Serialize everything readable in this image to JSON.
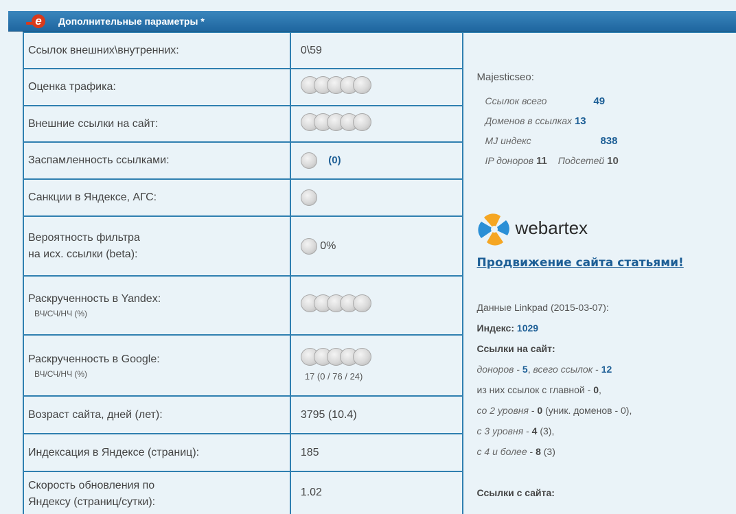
{
  "header": {
    "logo_letter": "e",
    "title": "Дополнительные параметры *"
  },
  "rows": [
    {
      "label": "Ссылок внешних\\внутренних:",
      "value": "0\\59"
    },
    {
      "label": "Оценка трафика:"
    },
    {
      "label": "Внешние ссылки на сайт:"
    },
    {
      "label": "Заспамленность ссылками:",
      "value": "(0)"
    },
    {
      "label": "Санкции в Яндексе, АГС:"
    },
    {
      "label1": "Вероятность фильтра",
      "label2": "на исх. ссылки (beta):",
      "value": "0%"
    },
    {
      "label1": "Раскрученность в Yandex:",
      "sub": "ВЧ/СЧ/НЧ (%)"
    },
    {
      "label1": "Раскрученность в Google:",
      "sub": "ВЧ/СЧ/НЧ (%)",
      "value": "17 (0 / 76 / 24)"
    },
    {
      "label": "Возраст сайта, дней (лет):",
      "value": "3795 (10.4)"
    },
    {
      "label": "Индексация в Яндексе (страниц):",
      "value": "185"
    },
    {
      "label1": "Скорость обновления по",
      "label2": "Яндексу (страниц/сутки):",
      "value": "1.02"
    }
  ],
  "majestic": {
    "title": "Majesticseo:",
    "links_label": "Ссылок всего",
    "links_value": "49",
    "domains_label": "Доменов в ссылках",
    "domains_value": "13",
    "mj_label": "MJ индекс",
    "mj_value": "838",
    "ip_label": "IP доноров",
    "ip_value": "11",
    "subnets_label": "Подсетей",
    "subnets_value": "10"
  },
  "webartex": {
    "brand": "webartex",
    "promo_link": "Продвижение сайта статьями!"
  },
  "linkpad": {
    "line1": "Данные Linkpad (2015-03-07):",
    "index_label": "Индекс:",
    "index_value": "1029",
    "links_to_site": "Ссылки на сайт:",
    "donors_label": "доноров",
    "donors_value": "5",
    "total_label": "всего ссылок",
    "total_value": "12",
    "from_main_label": "из них ссылок с главной",
    "from_main_value": "0",
    "lvl2_label": "со 2 уровня",
    "lvl2_value": "0",
    "lvl2_extra": "(уник. доменов - 0),",
    "lvl3_label": "с 3 уровня",
    "lvl3_value": "4",
    "lvl3_extra": "(3),",
    "lvl4_label": "с 4 и более",
    "lvl4_value": "8",
    "lvl4_extra": "(3)",
    "links_from_site": "Ссылки с сайта:"
  },
  "colors": {
    "border": "#2f7fb0",
    "header": "#2a77b0",
    "link": "#1e5f96",
    "logo_red": "#d93a1b"
  }
}
